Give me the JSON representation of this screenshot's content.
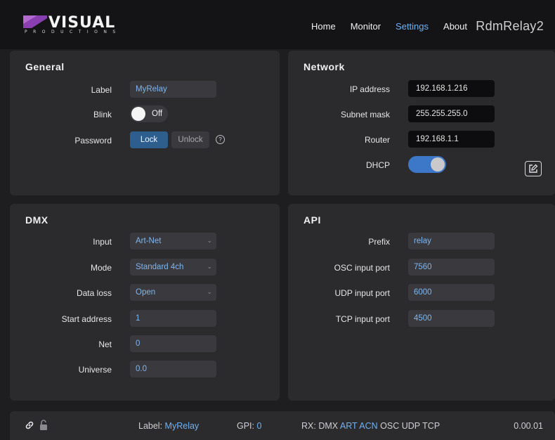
{
  "brand": {
    "name": "VISUAL",
    "tagline": "PRODUCTIONS"
  },
  "nav": {
    "items": [
      "Home",
      "Monitor",
      "Settings",
      "About"
    ],
    "active": "Settings"
  },
  "device_name": "RdmRelay2",
  "general": {
    "title": "General",
    "label_label": "Label",
    "label_value": "MyRelay",
    "blink_label": "Blink",
    "blink_state": "Off",
    "password_label": "Password",
    "lock_button": "Lock",
    "unlock_button": "Unlock",
    "help_icon": "?"
  },
  "network": {
    "title": "Network",
    "ip_label": "IP address",
    "ip_value": "192.168.1.216",
    "subnet_label": "Subnet mask",
    "subnet_value": "255.255.255.0",
    "router_label": "Router",
    "router_value": "192.168.1.1",
    "dhcp_label": "DHCP",
    "dhcp_on": true
  },
  "dmx": {
    "title": "DMX",
    "input_label": "Input",
    "input_value": "Art-Net",
    "mode_label": "Mode",
    "mode_value": "Standard 4ch",
    "dataloss_label": "Data loss",
    "dataloss_value": "Open",
    "start_label": "Start address",
    "start_value": "1",
    "net_label": "Net",
    "net_value": "0",
    "universe_label": "Universe",
    "universe_value": "0.0"
  },
  "api": {
    "title": "API",
    "prefix_label": "Prefix",
    "prefix_value": "relay",
    "osc_label": "OSC input port",
    "osc_value": "7560",
    "udp_label": "UDP input port",
    "udp_value": "6000",
    "tcp_label": "TCP input port",
    "tcp_value": "4500"
  },
  "footer": {
    "label_key": "Label:",
    "label_value": "MyRelay",
    "gpi_key": "GPI:",
    "gpi_value": "0",
    "rx_key": "RX:",
    "rx_dmx": "DMX",
    "rx_art": "ART",
    "rx_acn": "ACN",
    "rx_osc": "OSC",
    "rx_udp": "UDP",
    "rx_tcp": "TCP",
    "version": "0.00.01"
  },
  "colors": {
    "accent": "#6fb2f2",
    "toggle_on": "#3d78c8",
    "lock_button": "#2e5e8e",
    "logo": "#8a3fb0"
  },
  "icons": [
    "link-icon",
    "lock-open-icon",
    "edit-icon",
    "chevron-down-icon",
    "help-icon"
  ]
}
